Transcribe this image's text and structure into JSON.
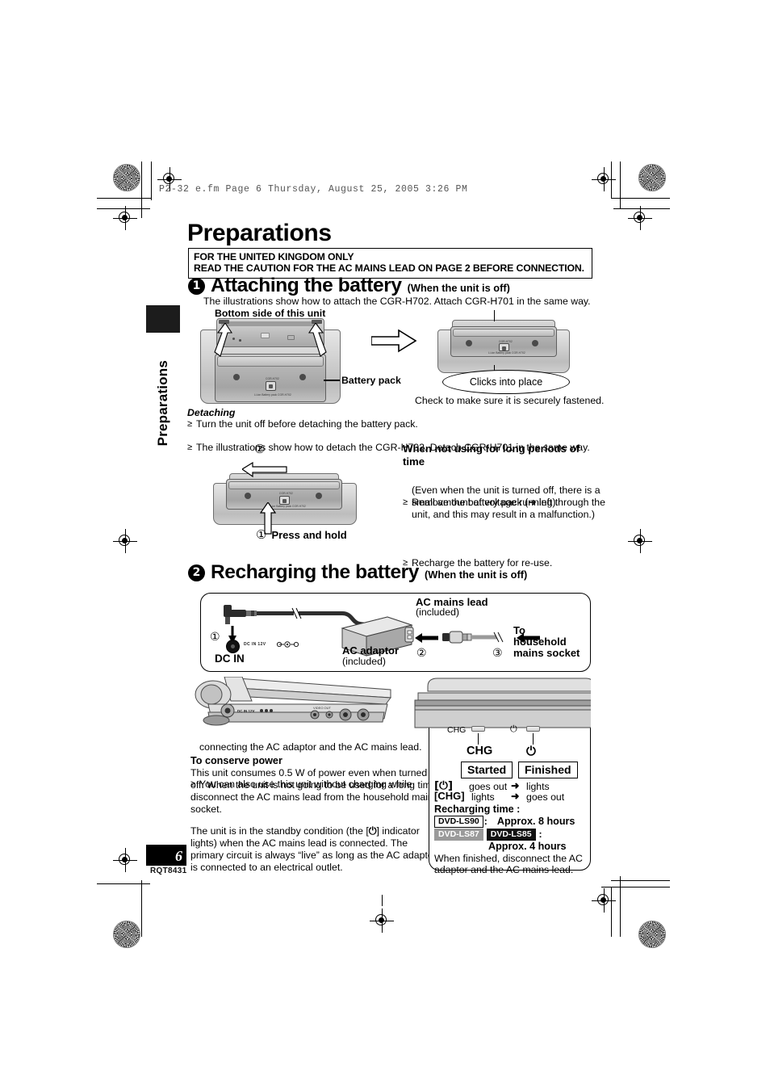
{
  "running_head": "P2-32 e.fm  Page 6  Thursday, August 25, 2005  3:26 PM",
  "page": {
    "title": "Preparations",
    "number": "6",
    "doc_code": "RQT8431",
    "side_tab": "Preparations"
  },
  "uk_notice": {
    "line1": "FOR THE UNITED KINGDOM ONLY",
    "line2": "READ THE CAUTION FOR THE AC MAINS LEAD ON PAGE 2 BEFORE CONNECTION."
  },
  "section1": {
    "number": "1",
    "title": "Attaching the battery",
    "subtitle": "(When the unit is off)",
    "intro": "The illustrations show how to attach the CGR-H702. Attach CGR-H701 in the same way.",
    "bottom_side_label": "Bottom side of this unit",
    "battery_pack_label": "Battery pack",
    "clicks_label": "Clicks into place",
    "check_label": "Check to make sure it is securely fastened.",
    "detaching": {
      "heading": "Detaching",
      "bullet1": "Turn the unit off before detaching the battery pack.",
      "bullet2": "The illustrations show how to detach the CGR-H702. Detach CGR-H701 in the same way.",
      "step2_mark": "②",
      "step1_mark": "①",
      "press_and_hold": "Press and hold"
    },
    "long_periods": {
      "heading": "When not using for long periods of time",
      "bullet1_line1": "Remove the battery pack (➜ left).",
      "bullet1_line2": "(Even when the unit is turned off, there is a",
      "bullet1_line3": "small amount of voltage running through the",
      "bullet1_line4": "unit, and this may result in a malfunction.)",
      "bullet2": "Recharge the battery for re-use."
    }
  },
  "section2": {
    "number": "2",
    "title": "Recharging the battery",
    "subtitle": "(When the unit is off)",
    "diagram": {
      "step1": "①",
      "step2": "②",
      "step3": "③",
      "dc_in_label": "DC IN",
      "dc_in_port_text": "DC IN 12V",
      "ac_adaptor_label": "AC adaptor",
      "ac_adaptor_note": "(included)",
      "ac_mains_lead_label": "AC mains lead",
      "ac_mains_lead_note": "(included)",
      "socket_label_line1": "To",
      "socket_label_line2": "household",
      "socket_label_line3": "mains socket"
    },
    "left_notes": {
      "bullet_line1": "You can also use this unit without charging while",
      "bullet_line2": "connecting the AC adaptor and the AC mains lead.",
      "conserve_heading": "To conserve power",
      "conserve_line1": "This unit consumes 0.5 W of power even when turned",
      "conserve_line2": "off. When the unit is not going to be used for a long time,",
      "conserve_line3": "disconnect the AC mains lead from the household mains",
      "conserve_line4": "socket.",
      "standby_line1": "The unit is in the standby condition (the [",
      "standby_line1b": "] indicator",
      "standby_line2": "lights) when the AC mains lead is connected. The",
      "standby_line3": "primary circuit is always “live” as long as the AC adaptor",
      "standby_line4": "is connected to an electrical outlet."
    },
    "indicator_panel": {
      "chg_small_label": "CHG",
      "chg_label": "CHG",
      "power_symbol": "⏻",
      "started": "Started",
      "finished": "Finished",
      "row_power_key": "[⏻]",
      "row_power_started": "goes out",
      "row_arrow": "➜",
      "row_power_finished": "lights",
      "row_chg_key": "[CHG]",
      "row_chg_started": "lights",
      "row_chg_finished": "goes out",
      "recharging_time_heading": "Recharging time :",
      "model_ls90": "DVD-LS90",
      "model_ls90_colon": ":",
      "time_ls90": "Approx. 8 hours",
      "model_ls87": "DVD-LS87",
      "model_ls85": "DVD-LS85",
      "model_ls85_colon": ":",
      "time_ls85": "Approx. 4 hours",
      "finish_note_line1": "When finished, disconnect the AC",
      "finish_note_line2": "adaptor and the AC mains lead."
    }
  }
}
